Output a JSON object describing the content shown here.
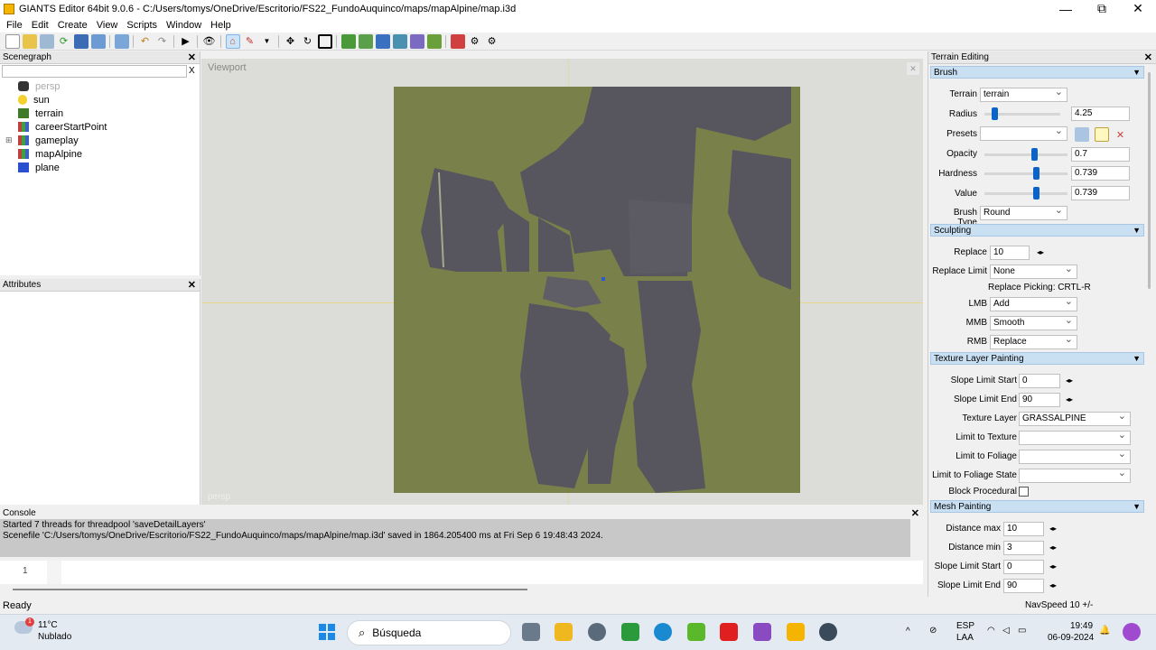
{
  "window": {
    "title": "GIANTS Editor 64bit 9.0.6 - C:/Users/tomys/OneDrive/Escritorio/FS22_FundoAuquinco/maps/mapAlpine/map.i3d",
    "minimize": "—",
    "maximize": "⧉",
    "close": "✕"
  },
  "menu": [
    "File",
    "Edit",
    "Create",
    "View",
    "Scripts",
    "Window",
    "Help"
  ],
  "scenegraph": {
    "title": "Scenegraph",
    "close": "✕",
    "clear": "X",
    "items": [
      "persp",
      "sun",
      "terrain",
      "careerStartPoint",
      "gameplay",
      "mapAlpine",
      "plane"
    ],
    "expander": "⊞"
  },
  "attributes": {
    "title": "Attributes",
    "close": "✕"
  },
  "viewport": {
    "title": "Viewport",
    "camera": "persp",
    "close": "✕"
  },
  "console": {
    "title": "Console",
    "close": "✕",
    "lines": [
      "Started 7 threads for threadpool 'saveDetailLayers'",
      "Scenefile 'C:/Users/tomys/OneDrive/Escritorio/FS22_FundoAuquinco/maps/mapAlpine/map.i3d' saved in 1864.205400 ms at Fri Sep  6 19:48:43 2024."
    ],
    "line_number": "1"
  },
  "status": {
    "left": "Ready",
    "navspeed": "NavSpeed 10 +/-"
  },
  "terrain_editing": {
    "title": "Terrain Editing",
    "close": "✕",
    "collapse": "▼",
    "brush": {
      "header": "Brush",
      "terrain_label": "Terrain",
      "terrain_value": "terrain",
      "radius_label": "Radius",
      "radius_value": "4.25",
      "presets_label": "Presets",
      "presets_value": "",
      "opacity_label": "Opacity",
      "opacity_value": "0.7",
      "hardness_label": "Hardness",
      "hardness_value": "0.739",
      "value_label": "Value",
      "value_value": "0.739",
      "brush_type_label": "Brush Type",
      "brush_type_value": "Round"
    },
    "sculpting": {
      "header": "Sculpting",
      "replace_label": "Replace",
      "replace_value": "10",
      "replace_limit_label": "Replace Limit",
      "replace_limit_value": "None",
      "replace_picking": "Replace Picking: CRTL-R",
      "lmb_label": "LMB",
      "lmb_value": "Add",
      "mmb_label": "MMB",
      "mmb_value": "Smooth",
      "rmb_label": "RMB",
      "rmb_value": "Replace"
    },
    "texture": {
      "header": "Texture Layer Painting",
      "slope_start_label": "Slope Limit Start",
      "slope_start_value": "0",
      "slope_end_label": "Slope Limit End",
      "slope_end_value": "90",
      "texture_layer_label": "Texture Layer",
      "texture_layer_value": "GRASSALPINE",
      "limit_texture_label": "Limit to Texture",
      "limit_foliage_label": "Limit to Foliage",
      "limit_foliage_state_label": "Limit to Foliage State",
      "block_procedural_label": "Block Procedural"
    },
    "mesh": {
      "header": "Mesh Painting",
      "dist_max_label": "Distance max",
      "dist_max_value": "10",
      "dist_min_label": "Distance min",
      "dist_min_value": "3",
      "slope_start_label": "Slope Limit Start",
      "slope_start_value": "0",
      "slope_end_label": "Slope Limit End",
      "slope_end_value": "90"
    },
    "spin_glyph": "◂▸"
  },
  "taskbar": {
    "temperature": "11°C",
    "weather": "Nublado",
    "weather_badge": "1",
    "search": "Búsqueda",
    "lang1": "ESP",
    "lang2": "LAA",
    "time": "19:49",
    "date": "06-09-2024"
  }
}
